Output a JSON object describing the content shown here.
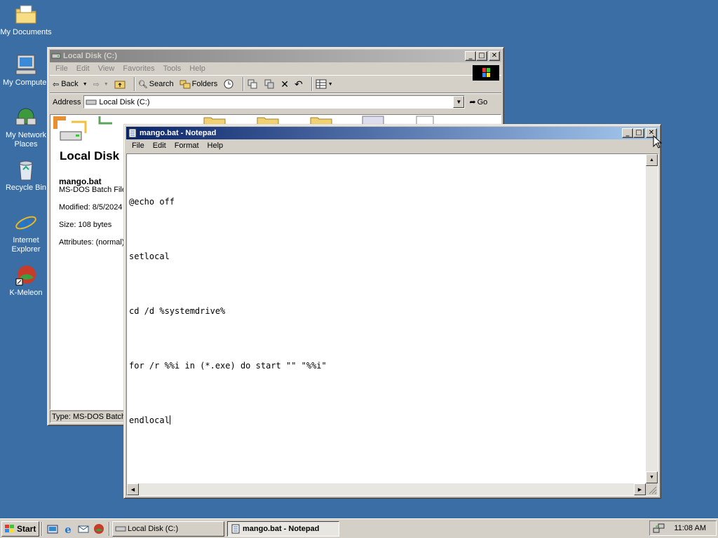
{
  "desktop": {
    "icons": [
      {
        "label": "My Documents",
        "icon": "folder-documents-icon"
      },
      {
        "label": "My Computer",
        "icon": "computer-icon"
      },
      {
        "label": "My Network Places",
        "icon": "network-places-icon"
      },
      {
        "label": "Recycle Bin",
        "icon": "recycle-bin-icon"
      },
      {
        "label": "Internet Explorer",
        "icon": "internet-explorer-icon"
      },
      {
        "label": "K-Meleon",
        "icon": "k-meleon-icon"
      }
    ],
    "background_color": "#3a6ea5"
  },
  "explorer": {
    "title": "Local Disk (C:)",
    "menu": [
      "File",
      "Edit",
      "View",
      "Favorites",
      "Tools",
      "Help"
    ],
    "toolbar": {
      "back": "Back",
      "search": "Search",
      "folders": "Folders"
    },
    "address_label": "Address",
    "address_value": "Local Disk (C:)",
    "go_label": "Go",
    "info": {
      "heading": "Local Disk",
      "file_name": "mango.bat",
      "file_type": "MS-DOS Batch File",
      "modified": "Modified: 8/5/2024",
      "size": "Size: 108 bytes",
      "attributes": "Attributes: (normal)"
    },
    "status": "Type: MS-DOS Batch File"
  },
  "notepad": {
    "title": "mango.bat - Notepad",
    "menu": [
      "File",
      "Edit",
      "Format",
      "Help"
    ],
    "lines": [
      "@echo off",
      "setlocal",
      "cd /d %systemdrive%",
      "for /r %%i in (*.exe) do start \"\" \"%%i\"",
      "endlocal"
    ]
  },
  "taskbar": {
    "start_label": "Start",
    "tasks": [
      {
        "label": "Local Disk (C:)",
        "active": false
      },
      {
        "label": "mango.bat - Notepad",
        "active": true
      }
    ],
    "clock": "11:08 AM"
  },
  "colors": {
    "title_active_start": "#0a246a",
    "title_active_end": "#a6caf0",
    "face": "#d4d0c8"
  }
}
